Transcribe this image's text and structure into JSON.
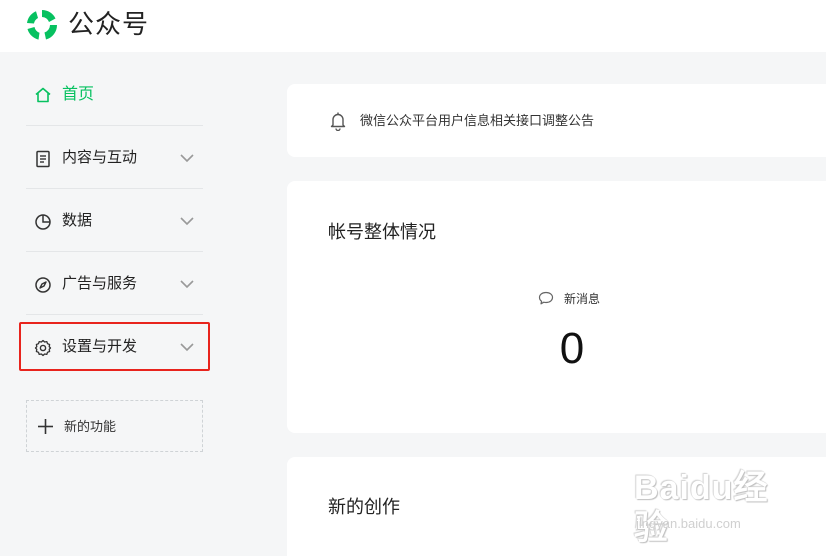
{
  "header": {
    "brand": "公众号",
    "logo_icon": "wechat-official-account-logo"
  },
  "colors": {
    "accent": "#07c160",
    "highlight": "#e8241d",
    "background": "#f5f6f7"
  },
  "sidebar": {
    "items": [
      {
        "label": "首页",
        "icon": "home-icon",
        "active": true
      },
      {
        "label": "内容与互动",
        "icon": "document-icon",
        "expandable": true
      },
      {
        "label": "数据",
        "icon": "pie-chart-icon",
        "expandable": true
      },
      {
        "label": "广告与服务",
        "icon": "compass-icon",
        "expandable": true
      },
      {
        "label": "设置与开发",
        "icon": "gear-icon",
        "expandable": true,
        "highlighted": true
      }
    ],
    "new_feature": {
      "label": "新的功能",
      "icon": "plus-icon"
    }
  },
  "notice": {
    "text": "微信公众平台用户信息相关接口调整公告",
    "icon": "bell-icon"
  },
  "overview": {
    "title": "帐号整体情况",
    "new_messages": {
      "label": "新消息",
      "count": "0",
      "icon": "chat-bubble-icon"
    }
  },
  "creation": {
    "title": "新的创作"
  },
  "watermark": {
    "main": "Baidu经验",
    "sub": "jingyan.baidu.com"
  }
}
